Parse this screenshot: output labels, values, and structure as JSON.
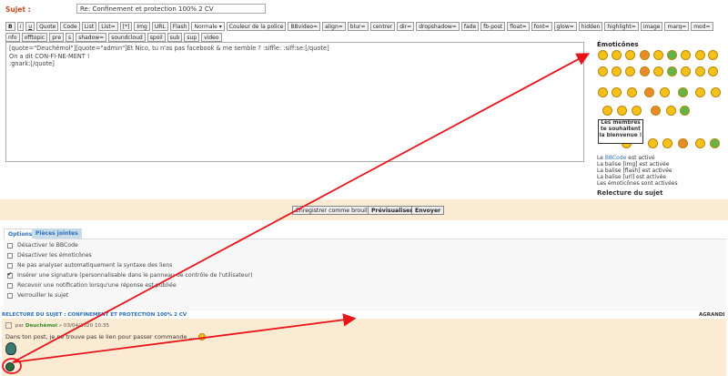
{
  "subject": {
    "label": "Sujet :",
    "value": "Re: Confinement et protection 100% 2 CV"
  },
  "toolbar": {
    "buttons": [
      "B",
      "i",
      "u",
      "Quote",
      "Code",
      "List",
      "List=",
      "[*]",
      "Img",
      "URL",
      "Flash"
    ],
    "font_select": "Normale",
    "buttons2": [
      "Couleur de la police",
      "BBvideo=",
      "align=",
      "blur=",
      "centrer",
      "dir=",
      "dropshadow=",
      "fade",
      "fb-post",
      "float=",
      "font=",
      "glow=",
      "hidden",
      "highlight=",
      "image",
      "marq=",
      "mod=",
      "nfo",
      "offtopic",
      "pre",
      "s",
      "shadow=",
      "soundcloud",
      "spoil",
      "sub",
      "sup",
      "video"
    ]
  },
  "editor": {
    "line1": "[quote=\"Deuchémol\"][quote=\"admin\"]Et Nico, tu n'as pas facebook & me semble ? :siffle: :siff:se:[/quote]",
    "line2": "On a dit CON-FI-NE-MENT !",
    "line3": ":gnark:[/quote]"
  },
  "emoticons": {
    "title": "Émoticônes",
    "welcome_sign": [
      "Les membres",
      "te souhaitent",
      "la bienvenue !"
    ]
  },
  "status": {
    "bbcode_link": "BBCode",
    "bbcode": "Le BBCode est activé",
    "img": "La balise [img] est activée",
    "flash": "La balise [flash] est activée",
    "url": "La balise [url] est activée",
    "smilies": "Les émoticônes sont activées"
  },
  "review_title": "Relecture du sujet",
  "actions": {
    "save_draft": "Enregistrer comme brouillon",
    "preview": "Prévisualiser",
    "submit": "Envoyer"
  },
  "tabs": {
    "options": "Options",
    "attachments": "Pièces jointes"
  },
  "options": [
    {
      "label": "Désactiver le BBCode",
      "checked": false
    },
    {
      "label": "Désactiver les émoticônes",
      "checked": false
    },
    {
      "label": "Ne pas analyser automatiquement la syntaxe des liens",
      "checked": false
    },
    {
      "label": "Insérer une signature (personnalisable dans le panneau de contrôle de l'utilisateur)",
      "checked": true
    },
    {
      "label": "Recevoir une notification lorsqu'une réponse est publiée",
      "checked": false
    },
    {
      "label": "Verrouiller le sujet",
      "checked": false
    }
  ],
  "topic_review": {
    "title": "RELECTURE DU SUJET : CONFINEMENT ET PROTECTION 100% 2 CV",
    "expand": "AGRANDI",
    "post_prefix": "par",
    "post_author": "Deuchémol",
    "post_date": "» 03/04/2020 10:35",
    "post_text": "Dans ton post, je ne trouve pas le lien pour passer commande .... "
  },
  "colors": {
    "label_orange": "#c24a1a",
    "link_blue": "#2a6ebb",
    "action_bar": "#fcebd3",
    "arrow_red": "#e8141b"
  }
}
